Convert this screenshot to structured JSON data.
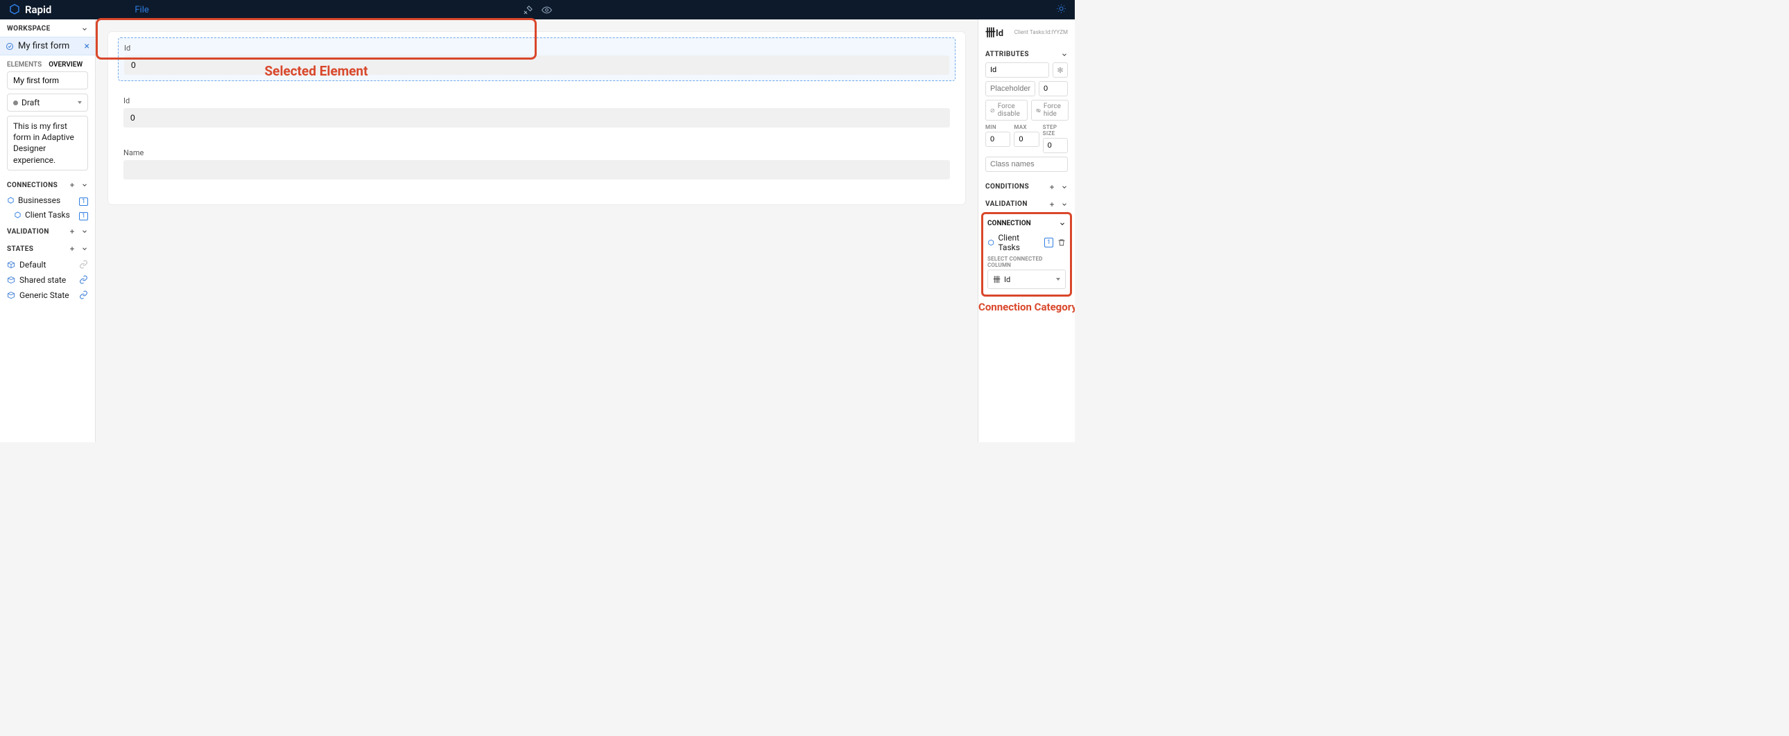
{
  "topbar": {
    "brand": "Rapid",
    "file_menu": "File"
  },
  "left": {
    "workspace_heading": "WORKSPACE",
    "workspace_item": "My first form",
    "tabs": {
      "elements": "ELEMENTS",
      "overview": "OVERVIEW"
    },
    "form_name": "My first form",
    "status": "Draft",
    "description": "This is my first form in Adaptive Designer experience.",
    "connections_heading": "CONNECTIONS",
    "connections": [
      {
        "label": "Businesses",
        "badge": "1"
      },
      {
        "label": "Client Tasks",
        "badge": "1"
      }
    ],
    "validation_heading": "VALIDATION",
    "states_heading": "STATES",
    "states": [
      {
        "label": "Default",
        "linked": false
      },
      {
        "label": "Shared state",
        "linked": true
      },
      {
        "label": "Generic State",
        "linked": true
      }
    ]
  },
  "canvas": {
    "fields": [
      {
        "label": "Id",
        "value": "0",
        "selected": true
      },
      {
        "label": "Id",
        "value": "0",
        "selected": false
      },
      {
        "label": "Name",
        "value": "",
        "selected": false
      }
    ],
    "annotation_selected": "Selected Element",
    "annotation_connection": "Connection Category"
  },
  "right": {
    "element_name": "Id",
    "element_meta": "Client Tasks:Id:IYYZM",
    "attributes_heading": "ATTRIBUTES",
    "attr_name": "Id",
    "placeholder_placeholder": "Placeholder",
    "default_value": "0",
    "force_disable": "Force disable",
    "force_hide": "Force hide",
    "min_label": "MIN",
    "max_label": "MAX",
    "step_label": "STEP SIZE",
    "min_val": "0",
    "max_val": "0",
    "step_val": "0",
    "class_placeholder": "Class names",
    "conditions_heading": "CONDITIONS",
    "validation_heading": "VALIDATION",
    "connection_heading": "CONNECTION",
    "connection_entity": "Client Tasks",
    "connection_badge": "1",
    "select_column_label": "SELECT CONNECTED COLUMN",
    "selected_column": "Id"
  }
}
